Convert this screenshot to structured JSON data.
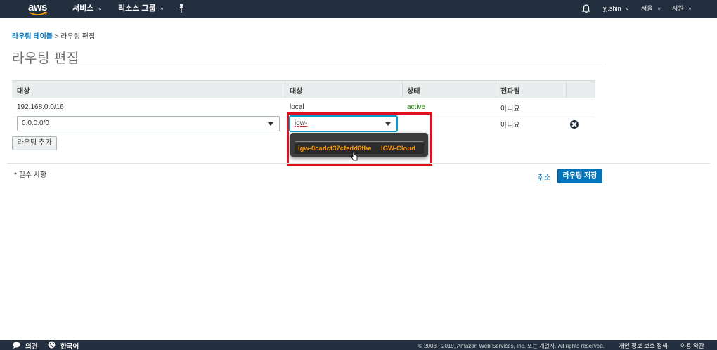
{
  "topnav": {
    "logo_text": "aws",
    "services_label": "서비스",
    "resource_groups_label": "리소스 그룹",
    "pin_icon": "pin-icon",
    "bell_icon": "bell-icon",
    "user_label": "yj.shin",
    "region_label": "서울",
    "support_label": "지원"
  },
  "breadcrumb": {
    "parent": "라우팅 테이블",
    "separator": ">",
    "current": "라우팅 편집"
  },
  "page_title": "라우팅 편집",
  "table": {
    "headers": [
      "대상",
      "대상",
      "상태",
      "전파됨"
    ],
    "rows": [
      {
        "destination": "192.168.0.0/16",
        "target": "local",
        "status": "active",
        "propagated": "아니요"
      },
      {
        "destination": "0.0.0.0/0",
        "target": "igw-",
        "status": "",
        "propagated": "아니요"
      }
    ]
  },
  "add_route_label": "라우팅 추가",
  "dropdown": {
    "option_id": "igw-0cadcf37cfedd6fbe",
    "option_name": "IGW-Cloud"
  },
  "required_label": "* 필수 사항",
  "cancel_label": "취소",
  "save_label": "라우팅 저장",
  "footer": {
    "feedback_label": "의견",
    "language_label": "한국어",
    "copyright": "© 2008 - 2019, Amazon Web Services, Inc. 또는 계열사. All rights reserved.",
    "privacy_label": "개인 정보 보호 정책",
    "terms_label": "이용 약관"
  },
  "colors": {
    "nav_bg": "#232f3e",
    "link": "#0073bb",
    "status_active": "#1d8102",
    "dropdown_text": "#ff9900",
    "highlight": "#e0101e"
  }
}
